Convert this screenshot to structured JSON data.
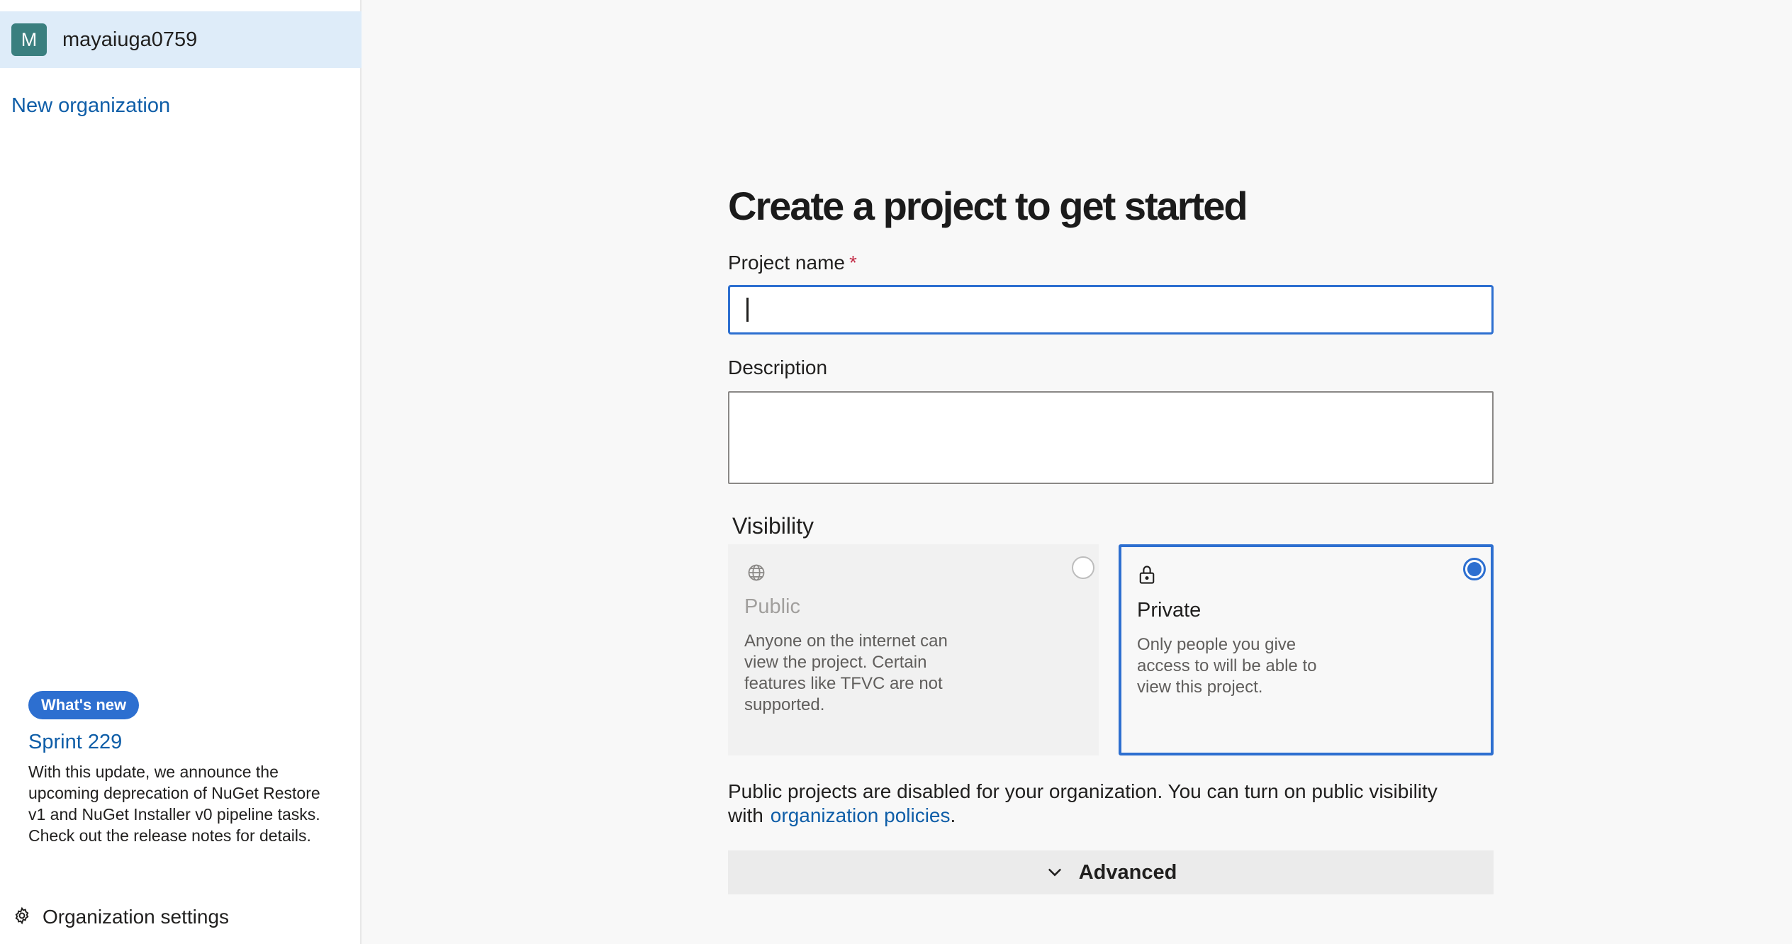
{
  "sidebar": {
    "org": {
      "avatar_letter": "M",
      "name": "mayaiuga0759"
    },
    "new_org_label": "New organization",
    "whats_new": {
      "badge": "What's new",
      "title": "Sprint 229",
      "description": "With this update, we announce the upcoming deprecation of NuGet Restore v1 and NuGet Installer v0 pipeline tasks. Check out the release notes for details."
    },
    "settings_label": "Organization settings"
  },
  "main": {
    "title": "Create a project to get started",
    "project_name": {
      "label": "Project name",
      "required_marker": "*",
      "value": ""
    },
    "description": {
      "label": "Description",
      "value": ""
    },
    "visibility": {
      "label": "Visibility",
      "options": [
        {
          "title": "Public",
          "description": "Anyone on the internet can view the project. Certain features like TFVC are not supported.",
          "selected": false,
          "disabled": true,
          "icon": "globe-icon"
        },
        {
          "title": "Private",
          "description": "Only people you give access to will be able to view this project.",
          "selected": true,
          "disabled": false,
          "icon": "lock-icon"
        }
      ]
    },
    "notice": {
      "text": "Public projects are disabled for your organization. You can turn on public visibility with",
      "link": "organization policies",
      "suffix": "."
    },
    "advanced_label": "Advanced"
  },
  "colors": {
    "accent": "#2d6fd0",
    "link": "#0f5ea8",
    "avatar": "#3a7f7f",
    "selected_row": "#deecf9"
  }
}
